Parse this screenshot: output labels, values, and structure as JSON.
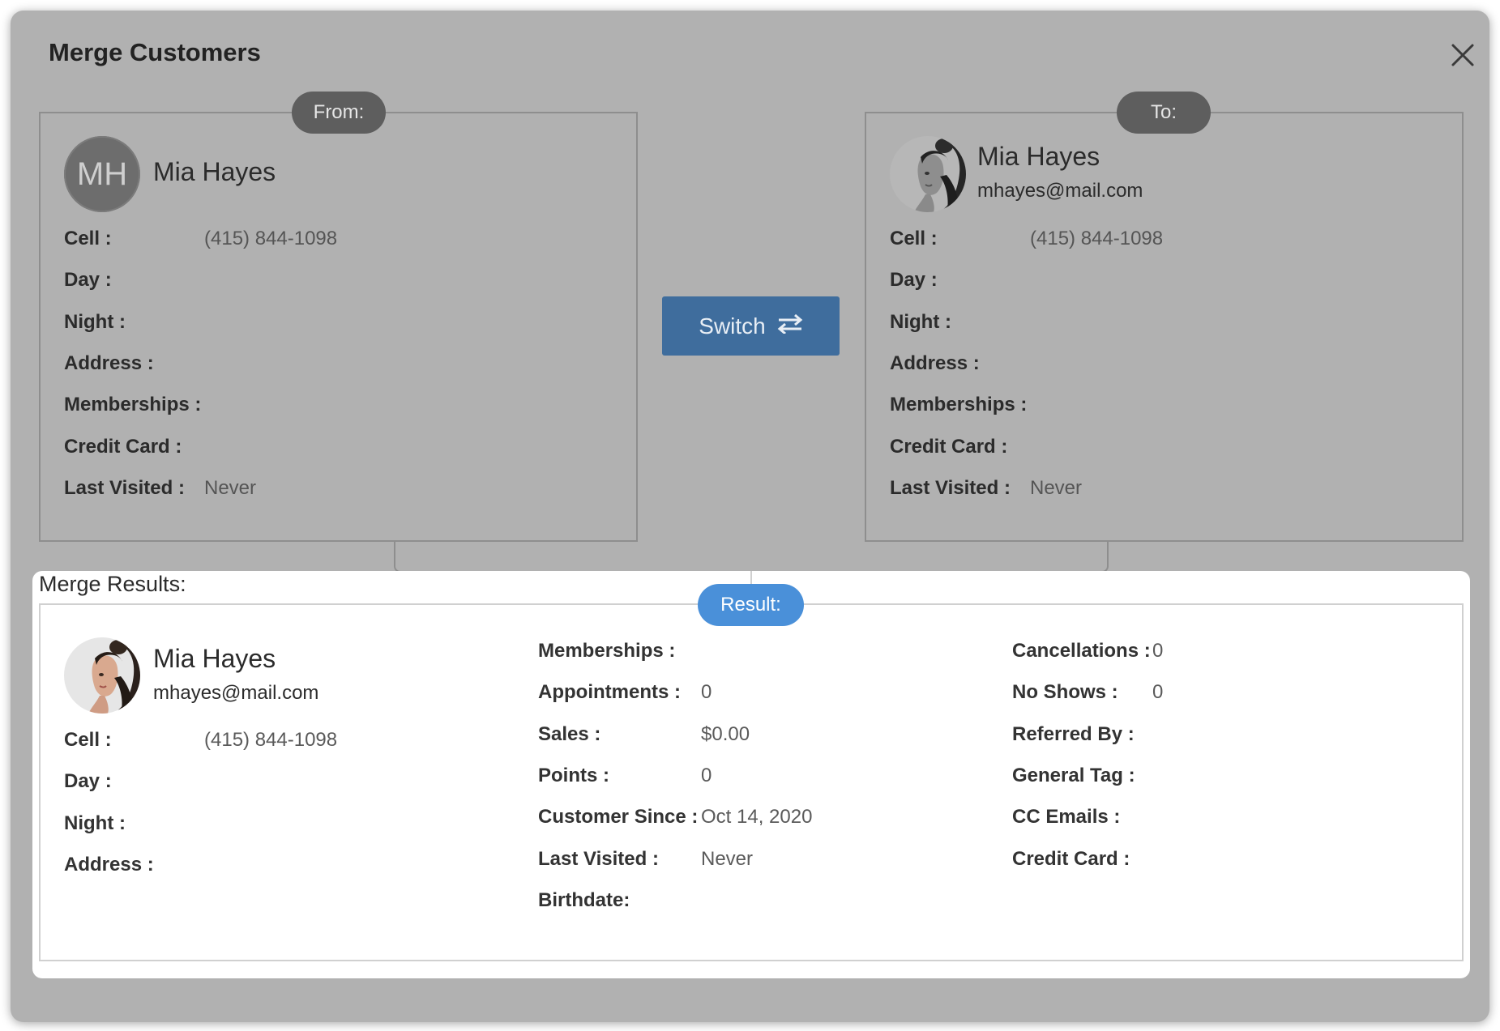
{
  "dialog": {
    "title": "Merge Customers"
  },
  "from": {
    "badge": "From:",
    "initials": "MH",
    "name": "Mia Hayes",
    "fields": [
      {
        "label": "Cell :",
        "value": "(415) 844-1098"
      },
      {
        "label": "Day :",
        "value": ""
      },
      {
        "label": "Night :",
        "value": ""
      },
      {
        "label": "Address :",
        "value": ""
      },
      {
        "label": "Memberships :",
        "value": ""
      },
      {
        "label": "Credit Card :",
        "value": ""
      },
      {
        "label": "Last Visited :",
        "value": "Never"
      }
    ]
  },
  "to": {
    "badge": "To:",
    "name": "Mia Hayes",
    "email": "mhayes@mail.com",
    "fields": [
      {
        "label": "Cell :",
        "value": "(415) 844-1098"
      },
      {
        "label": "Day :",
        "value": ""
      },
      {
        "label": "Night :",
        "value": ""
      },
      {
        "label": "Address :",
        "value": ""
      },
      {
        "label": "Memberships :",
        "value": ""
      },
      {
        "label": "Credit Card :",
        "value": ""
      },
      {
        "label": "Last Visited :",
        "value": "Never"
      }
    ]
  },
  "switch": {
    "label": "Switch"
  },
  "result": {
    "section_title": "Merge Results:",
    "badge": "Result:",
    "name": "Mia Hayes",
    "email": "mhayes@mail.com",
    "contact_fields": [
      {
        "label": "Cell :",
        "value": "(415) 844-1098"
      },
      {
        "label": "Day :",
        "value": ""
      },
      {
        "label": "Night :",
        "value": ""
      },
      {
        "label": "Address :",
        "value": ""
      }
    ],
    "stats_fields": [
      {
        "label": "Memberships :",
        "value": ""
      },
      {
        "label": "Appointments :",
        "value": "0"
      },
      {
        "label": "Sales :",
        "value": "$0.00"
      },
      {
        "label": "Points :",
        "value": "0"
      },
      {
        "label": "Customer Since :",
        "value": "Oct 14, 2020"
      },
      {
        "label": "Last Visited :",
        "value": "Never"
      },
      {
        "label": "Birthdate:",
        "value": ""
      }
    ],
    "other_fields": [
      {
        "label": "Cancellations :",
        "value": "0"
      },
      {
        "label": "No Shows :",
        "value": "0"
      },
      {
        "label": "Referred By :",
        "value": ""
      },
      {
        "label": "General Tag :",
        "value": ""
      },
      {
        "label": "CC Emails :",
        "value": ""
      },
      {
        "label": "Credit Card :",
        "value": ""
      }
    ]
  },
  "colors": {
    "overlay": "#b1b1b1",
    "switch_button": "#3f6d9d",
    "result_badge": "#4a90d9",
    "badge_dark": "#5e5e5e"
  },
  "icons": {
    "close": "close-icon",
    "switch": "swap-arrows-icon"
  }
}
